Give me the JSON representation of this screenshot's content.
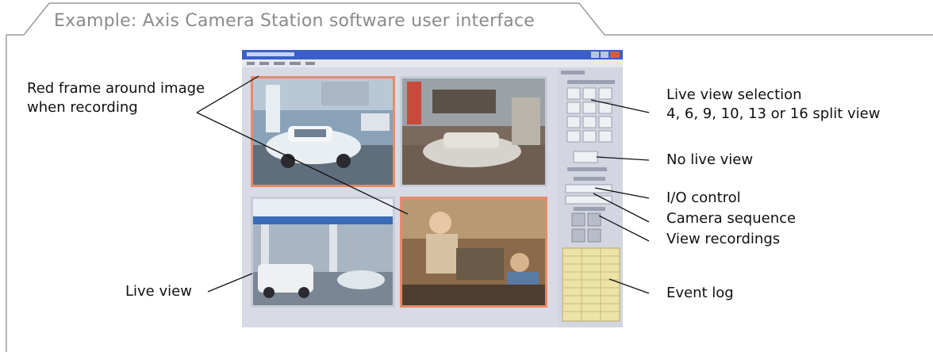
{
  "figure": {
    "title": "Example: Axis Camera Station software user interface"
  },
  "callouts": {
    "red_frame_line1": "Red frame around image",
    "red_frame_line2": "when recording",
    "live_view": "Live view",
    "live_view_selection": "Live view selection",
    "split_options": "4, 6, 9, 10, 13 or 16 split view",
    "no_live_view": "No live view",
    "io_control": "I/O control",
    "camera_sequence": "Camera sequence",
    "view_recordings": "View recordings",
    "event_log": "Event log"
  },
  "colors": {
    "frame_line": "#9a9a9a",
    "leader_line": "#111111",
    "recording_frame": "#e88a6a",
    "app_background": "#d8dbe6",
    "titlebar": "#3a5fc8",
    "event_log_bg": "#ede3a6"
  },
  "icons": [
    "camera-feed-parking",
    "camera-feed-garage",
    "camera-feed-gas-station",
    "camera-feed-store"
  ]
}
